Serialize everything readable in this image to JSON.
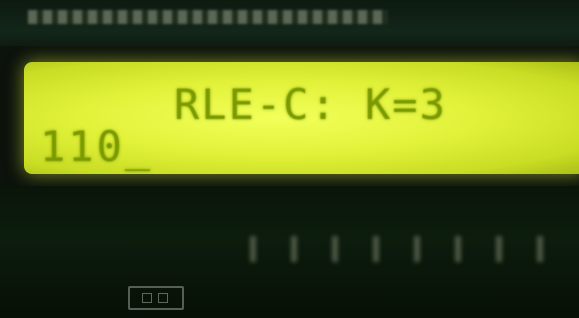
{
  "lcd": {
    "line1": "RLE-C: K=3",
    "line2": "110_"
  },
  "colors": {
    "backlight": "#e2f23a",
    "segment_text": "#7a9a00",
    "pcb": "#0c1c0d"
  }
}
